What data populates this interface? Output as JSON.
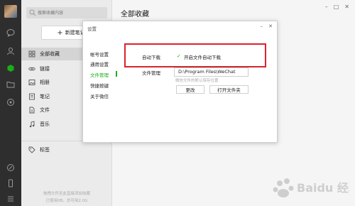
{
  "rail": {
    "icons": [
      "avatar",
      "chat-icon",
      "contacts-icon",
      "favorites-icon",
      "files-icon",
      "mini-programs-icon",
      "moments-icon",
      "phone-icon",
      "menu-icon"
    ]
  },
  "sidebar": {
    "search_placeholder": "搜索收藏内容",
    "new_note_label": "新建笔记",
    "categories": [
      {
        "label": "全部收藏",
        "icon": "grid-icon"
      },
      {
        "label": "链接",
        "icon": "link-icon"
      },
      {
        "label": "相册",
        "icon": "image-icon"
      },
      {
        "label": "笔记",
        "icon": "note-icon"
      },
      {
        "label": "文件",
        "icon": "file-icon"
      },
      {
        "label": "音乐",
        "icon": "music-icon"
      }
    ],
    "tags_label": "标签",
    "footer_line1": "拖拽文件至此直接添加收藏",
    "footer_line2": "已使用0B，总可用2.0G"
  },
  "main": {
    "title": "全部收藏",
    "window_controls": [
      "–",
      "□",
      "✕"
    ]
  },
  "dialog": {
    "title": "设置",
    "nav": [
      "帐号设置",
      "通用设置",
      "文件管理",
      "快捷按键",
      "关于微信"
    ],
    "active_nav_index": 2,
    "auto_download_label": "自动下载",
    "auto_download_option": "开启文件自动下载",
    "auto_download_checked": true,
    "file_manage_label": "文件管理",
    "path_value": "D:\\Program Files\\WeChat",
    "path_hint": "微信文件的默认保存位置",
    "change_button": "更改",
    "open_folder_button": "打开文件夹",
    "min_label": "–",
    "close_label": "✕"
  },
  "colors": {
    "accent_green": "#1aad19",
    "highlight_red": "#d9242b",
    "rail_bg": "#2e2e2e"
  },
  "watermark": "Baidu 经验"
}
